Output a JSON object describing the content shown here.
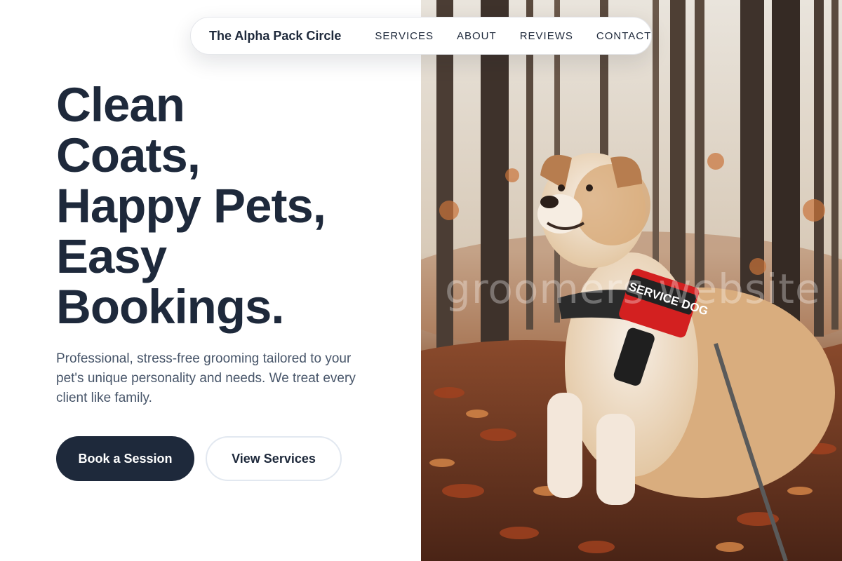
{
  "nav": {
    "brand": "The Alpha Pack Circle",
    "links": [
      "SERVICES",
      "ABOUT",
      "REVIEWS",
      "CONTACT"
    ]
  },
  "hero": {
    "headline_lines": [
      "Clean",
      "Coats,",
      "Happy Pets,",
      "Easy",
      "Bookings."
    ],
    "subtext": "Professional, stress-free grooming tailored to your pet's unique personality and needs. We treat every client like family.",
    "primary_button": "Book a Session",
    "secondary_button": "View Services"
  },
  "image": {
    "harness_text": "SERVICE DOG",
    "watermark": "groomers website"
  },
  "colors": {
    "primary": "#1e293b",
    "body_text": "#475569",
    "border": "#e2e8f0",
    "harness_red": "#d32020"
  }
}
